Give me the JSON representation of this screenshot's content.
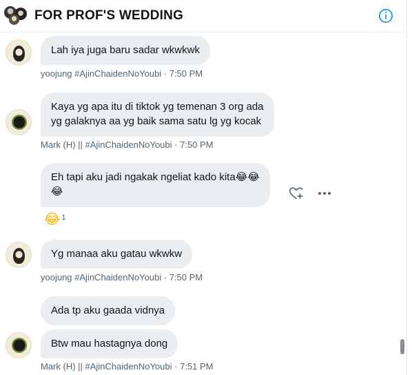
{
  "header": {
    "title": "FOR PROF'S WEDDING"
  },
  "messages": [
    {
      "sender": "yoojung",
      "text": "Lah iya juga baru sadar wkwkwk",
      "meta": "yoojung #AjinChaidenNoYoubi · 7:50 PM"
    },
    {
      "sender": "mark",
      "line1": "Kaya yg apa itu di tiktok yg temenan 3 org ada",
      "line2": "yg galaknya aa yg baik sama satu lg yg kocak",
      "meta": "Mark (H) || #AjinChaidenNoYoubi · 7:50 PM"
    },
    {
      "sender": "me",
      "line1": "Eh tapi aku jadi ngakak ngeliat kado kita",
      "line1_emoji": "😂😂",
      "line2_emoji": "😂",
      "reaction_emoji": "😂",
      "reaction_count": "1"
    },
    {
      "sender": "yoojung",
      "text": "Yg manaa aku gatau wkwkw",
      "meta": "yoojung #AjinChaidenNoYoubi · 7:50 PM"
    },
    {
      "sender": "mark",
      "text": "Ada tp aku gaada vidnya"
    },
    {
      "sender": "mark",
      "text": "Btw mau hastagnya dong",
      "meta": "Mark (H) || #AjinChaidenNoYoubi · 7:51 PM"
    }
  ],
  "icons": {
    "info": "info-icon",
    "react": "heart-plus-icon",
    "more": "more-icon"
  },
  "colors": {
    "bubble": "#ebeef0",
    "accent": "#1d9bf0",
    "meta": "#536471"
  }
}
